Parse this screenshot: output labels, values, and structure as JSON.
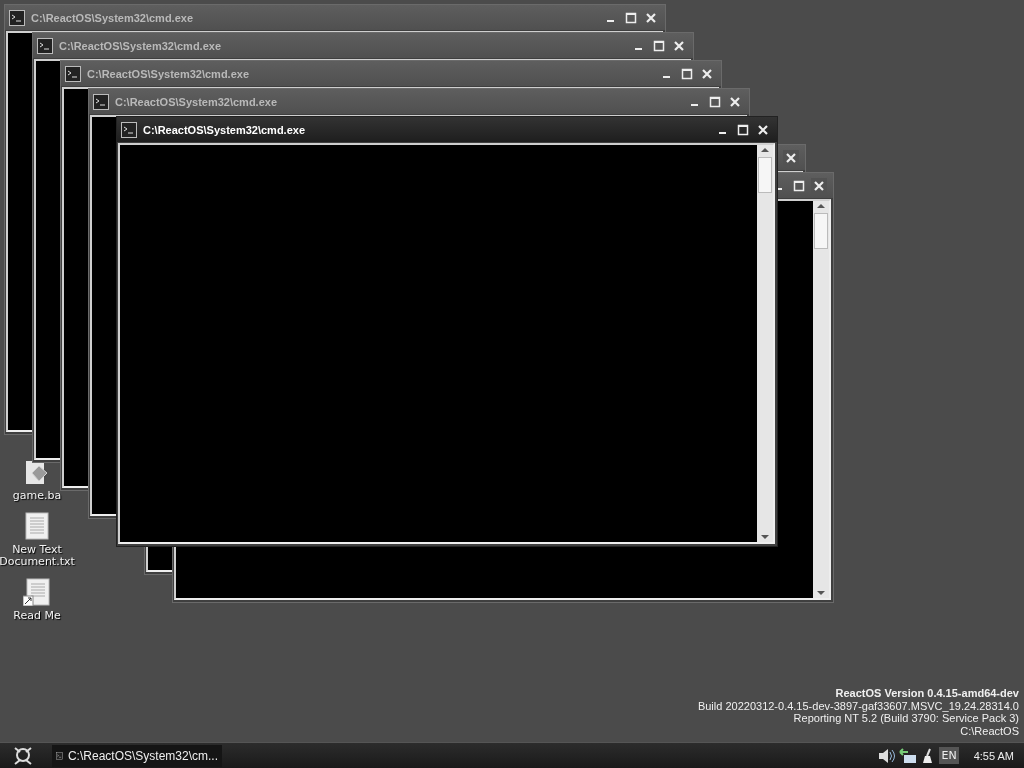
{
  "desktop_icons": [
    {
      "kind": "batch",
      "label": "game.ba"
    },
    {
      "kind": "text",
      "label": "New Text Document.txt"
    },
    {
      "kind": "shortcut",
      "label": "Read Me"
    }
  ],
  "windows": [
    {
      "title": "C:\\ReactOS\\System32\\cmd.exe",
      "active": false
    },
    {
      "title": "C:\\ReactOS\\System32\\cmd.exe",
      "active": false
    },
    {
      "title": "C:\\ReactOS\\System32\\cmd.exe",
      "active": false
    },
    {
      "title": "C:\\ReactOS\\System32\\cmd.exe",
      "active": false
    },
    {
      "title": "C:\\ReactOS\\System32\\cmd.exe",
      "active": true,
      "scrollbar": true
    },
    {
      "active": false
    },
    {
      "active": false,
      "scrollbar": true
    }
  ],
  "version_info": {
    "title": "ReactOS Version 0.4.15-amd64-dev",
    "lines": [
      "Build 20220312-0.4.15-dev-3897-gaf33607.MSVC_19.24.28314.0",
      "Reporting NT 5.2 (Build 3790: Service Pack 3)",
      "C:\\ReactOS"
    ]
  },
  "taskbar": {
    "tasks": [
      {
        "label": "C:\\ReactOS\\System32\\cm...",
        "selected": false
      }
    ],
    "language": "EN",
    "clock": "4:55 AM"
  }
}
